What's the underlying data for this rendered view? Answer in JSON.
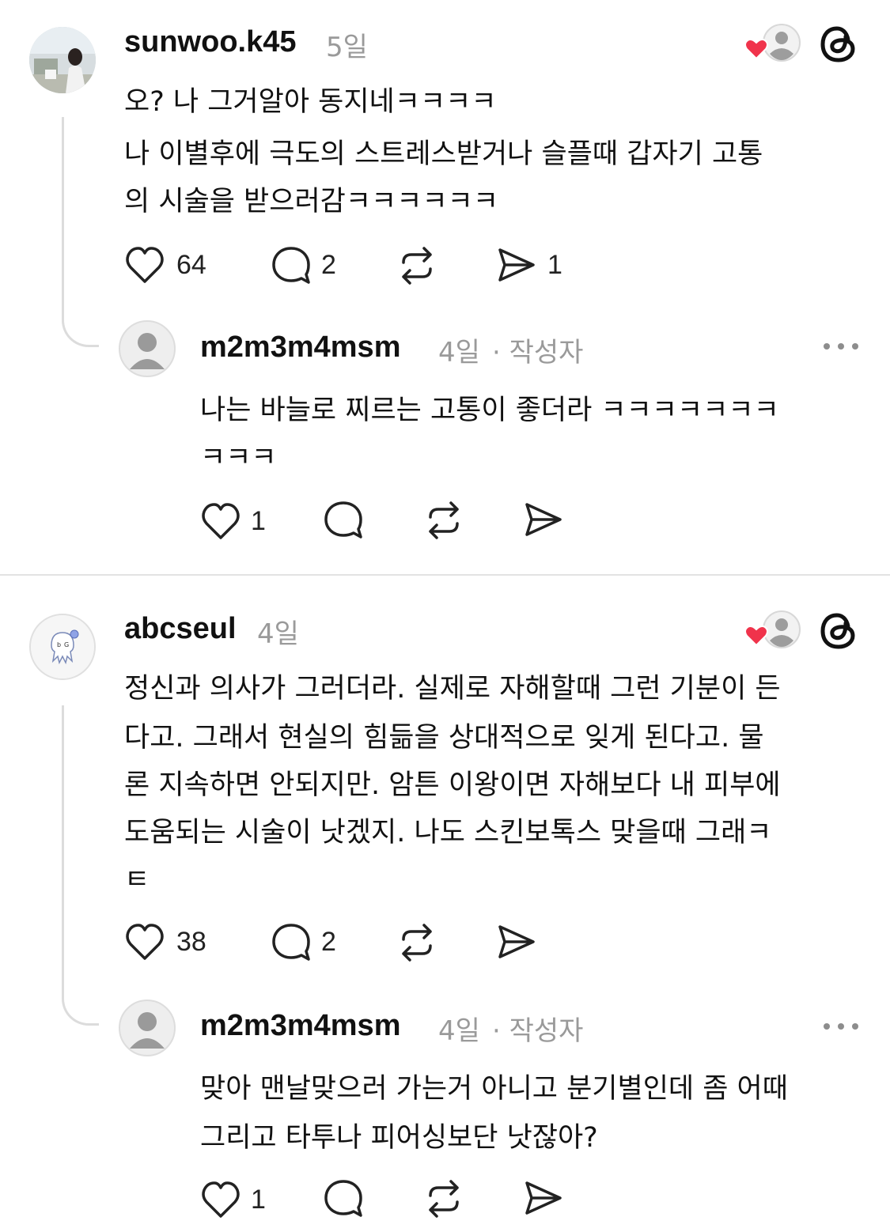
{
  "comments": [
    {
      "username": "sunwoo.k45",
      "time": "5일",
      "lines": [
        "오? 나 그거알아 동지네ㅋㅋㅋㅋ",
        "나 이별후에 극도의 스트레스받거나 슬플때 갑자기 고통",
        "의 시술을 받으러감ㅋㅋㅋㅋㅋㅋ"
      ],
      "likes": "64",
      "replies": "2",
      "shares": "1",
      "reply": {
        "username": "m2m3m4msm",
        "time": "4일",
        "author_tag": "· 작성자",
        "lines": [
          "나는 바늘로 찌르는 고통이 좋더라 ㅋㅋㅋㅋㅋㅋㅋ",
          "ㅋㅋㅋ"
        ],
        "likes": "1"
      }
    },
    {
      "username": "abcseul",
      "time": "4일",
      "lines": [
        "정신과 의사가 그러더라. 실제로 자해할때 그런 기분이 든",
        "다고. 그래서 현실의 힘듦을 상대적으로 잊게 된다고. 물",
        "론 지속하면 안되지만. 암튼 이왕이면 자해보다 내 피부에",
        "도움되는 시술이 낫겠지. 나도 스킨보톡스 맞을때 그래ㅋ",
        "ㅌ"
      ],
      "likes": "38",
      "replies": "2",
      "reply": {
        "username": "m2m3m4msm",
        "time": "4일",
        "author_tag": "· 작성자",
        "lines": [
          "맞아 맨날맞으러 가는거 아니고 분기별인데 좀 어때",
          "그리고 타투나 피어싱보단 낫잖아?"
        ],
        "likes": "1"
      }
    }
  ],
  "icons": {
    "like": "heart-outline-icon",
    "reply": "comment-bubble-icon",
    "repost": "repost-icon",
    "share": "send-icon",
    "threads": "threads-logo-icon",
    "liked_by": "liked-by-author-icon",
    "more": "more-options-icon"
  },
  "colors": {
    "heart": "#f0334b",
    "muted": "#9a9a9a",
    "text": "#111111"
  }
}
